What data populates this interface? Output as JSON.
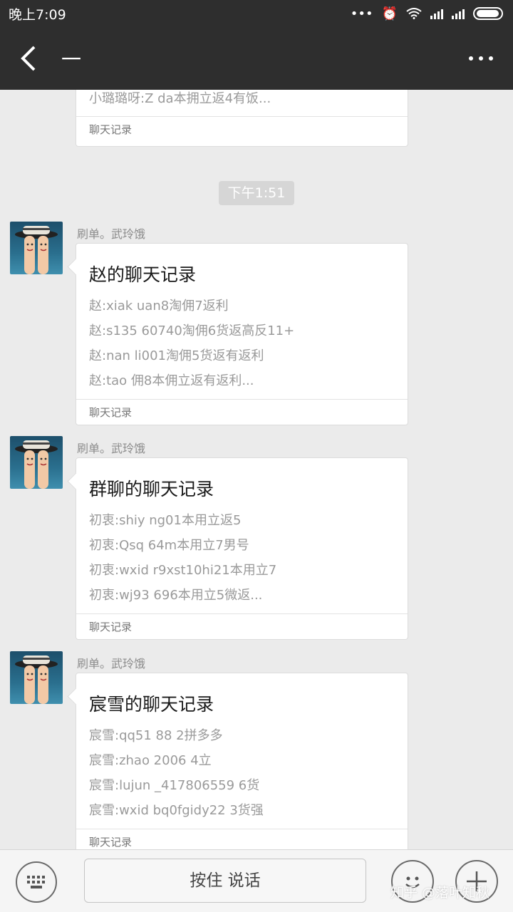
{
  "status_bar": {
    "time": "晚上7:09",
    "icons": [
      "dots-icon",
      "alarm-icon",
      "wifi-icon",
      "signal-icon",
      "signal-icon",
      "battery-icon"
    ]
  },
  "header": {
    "title": "一",
    "back_icon": "back-arrow-icon",
    "more_icon": "more-dots-icon"
  },
  "messages": {
    "partial_card": {
      "line": "小璐璐呀:Z    da本拥立返4有饭...",
      "footer": "聊天记录"
    },
    "timestamp": "下午1:51",
    "items": [
      {
        "sender": "刷单。武玲饿",
        "title": "赵的聊天记录",
        "lines": [
          "赵:xiak  uan8淘佣7返利",
          "赵:s135  60740淘佣6货返高反11+",
          "赵:nan  li001淘佣5货返有返利",
          "赵:tao  佣8本佣立返有返利..."
        ],
        "footer": "聊天记录"
      },
      {
        "sender": "刷单。武玲饿",
        "title": "群聊的聊天记录",
        "lines": [
          "初衷:shiy  ng01本用立返5",
          "初衷:Qsq  64m本用立7男号",
          "初衷:wxid  r9xst10hi21本用立7",
          "初衷:wj93  696本用立5微返..."
        ],
        "footer": "聊天记录"
      },
      {
        "sender": "刷单。武玲饿",
        "title": "宸雪的聊天记录",
        "lines": [
          "宸雪:qq51  88   2拼多多",
          "宸雪:zhao  2006   4立",
          "宸雪:lujun  _417806559   6货",
          "宸雪:wxid  bq0fgidy22   3货强"
        ],
        "footer": "聊天记录"
      }
    ]
  },
  "bottom_bar": {
    "hold_to_talk": "按住 说话",
    "keyboard_icon": "keyboard-icon",
    "emoji_icon": "emoji-icon",
    "plus_icon": "plus-icon"
  },
  "watermark": "知乎 @落叶知秋"
}
